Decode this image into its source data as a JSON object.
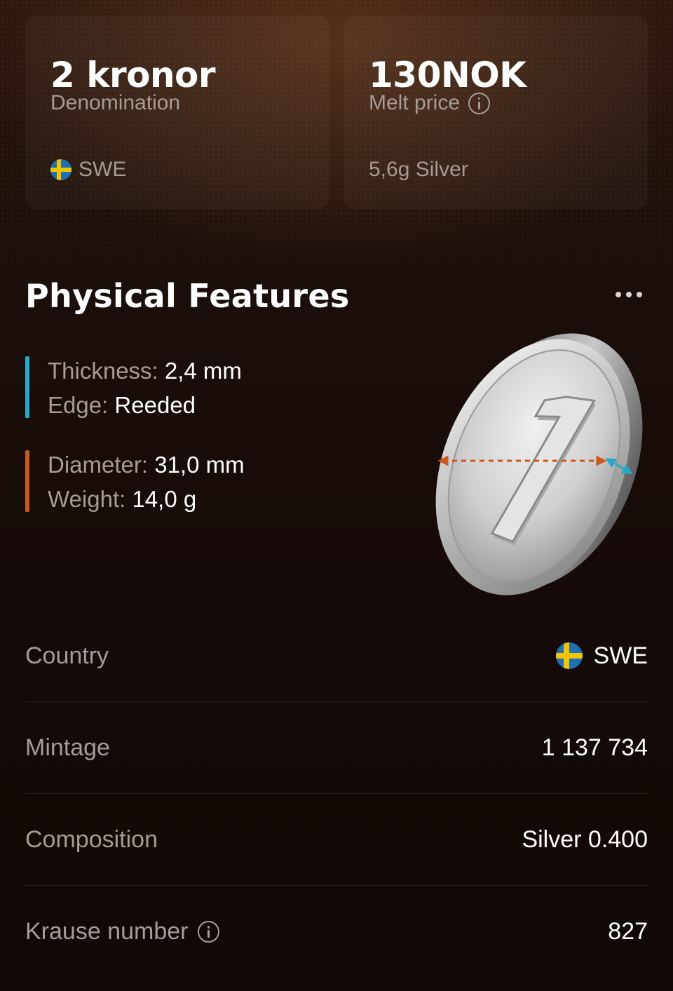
{
  "cards": {
    "denomination": {
      "value": "2 kronor",
      "label": "Denomination",
      "country_icon": "sweden-flag-icon",
      "country_code": "SWE"
    },
    "melt": {
      "value": "130NOK",
      "label": "Melt price",
      "info_icon": "info-icon",
      "metal": "5,6g Silver"
    }
  },
  "physical": {
    "title": "Physical Features",
    "more_icon": "more-dots-icon",
    "group1_color": "#2aa7c9",
    "group2_color": "#c85a1e",
    "thickness_label": "Thickness:",
    "thickness_value": "2,4 mm",
    "edge_label": "Edge:",
    "edge_value": "Reeded",
    "diameter_label": "Diameter:",
    "diameter_value": "31,0 mm",
    "weight_label": "Weight:",
    "weight_value": "14,0 g",
    "coin_icon": "coin-illustration",
    "coin_numeral": "1"
  },
  "details": [
    {
      "label": "Country",
      "value": "SWE",
      "flag": "sweden-flag-icon"
    },
    {
      "label": "Mintage",
      "value": "1 137 734"
    },
    {
      "label": "Composition",
      "value": "Silver 0.400"
    },
    {
      "label": "Krause number",
      "value": "827",
      "info": "info-icon"
    }
  ]
}
